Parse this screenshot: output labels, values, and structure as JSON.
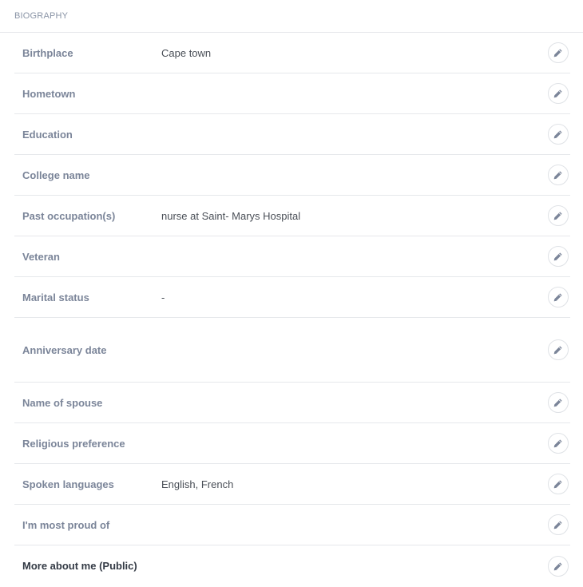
{
  "section": {
    "title": "BIOGRAPHY"
  },
  "rows": [
    {
      "label": "Birthplace",
      "value": "Cape town"
    },
    {
      "label": "Hometown",
      "value": ""
    },
    {
      "label": "Education",
      "value": ""
    },
    {
      "label": "College name",
      "value": ""
    },
    {
      "label": "Past occupation(s)",
      "value": "nurse at Saint- Marys Hospital"
    },
    {
      "label": "Veteran",
      "value": ""
    },
    {
      "label": "Marital status",
      "value": "-"
    },
    {
      "label": "Anniversary date",
      "value": ""
    },
    {
      "label": "Name of spouse",
      "value": ""
    },
    {
      "label": "Religious preference",
      "value": ""
    },
    {
      "label": "Spoken languages",
      "value": "English, French"
    },
    {
      "label": "I'm most proud of",
      "value": ""
    },
    {
      "label": "More about me (Public)",
      "value": ""
    }
  ],
  "icons": {
    "edit": "pencil-icon"
  },
  "colors": {
    "label": "#7b8599",
    "label_emphasis": "#333a45",
    "value": "#4a4f57",
    "divider": "#e6e8eb",
    "icon": "#7b8599"
  }
}
